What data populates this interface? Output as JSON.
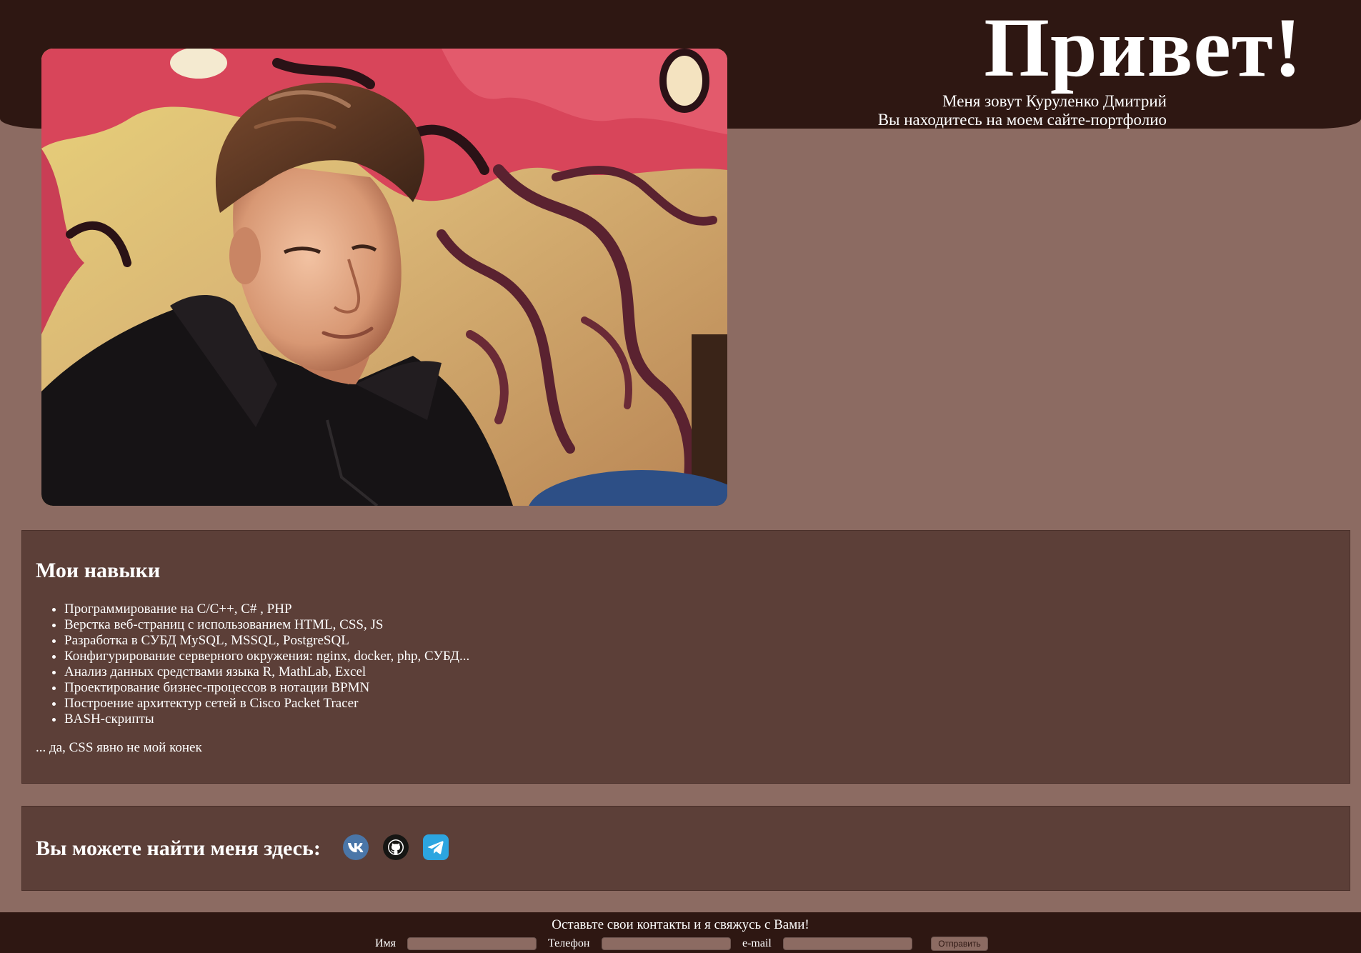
{
  "hero": {
    "title": "Привет!",
    "line1": "Меня зовут Куруленко Дмитрий",
    "line2": "Вы находитесь на моем сайте-портфолио"
  },
  "skills": {
    "heading": "Мои навыки",
    "items": [
      "Программирование на C/C++, C# , PHP",
      "Верстка веб-страниц с использованием HTML, CSS, JS",
      "Разработка в СУБД MySQL, MSSQL, PostgreSQL",
      "Конфигурирование серверного окружения: nginx, docker, php, СУБД...",
      "Анализ данных средствами языка R, MathLab, Excel",
      "Проектирование бизнес-процессов в нотации BPMN",
      "Построение архитектур сетей в Cisco Packet Tracer",
      "BASH-скрипты"
    ],
    "note": "... да, CSS явно не мой конек"
  },
  "socials": {
    "heading": "Вы можете найти меня здесь:",
    "links": [
      {
        "icon": "vk-icon",
        "color": "#4a76a8"
      },
      {
        "icon": "github-icon",
        "color": "#161614"
      },
      {
        "icon": "telegram-icon",
        "color": "#2ca5e0"
      }
    ]
  },
  "footer": {
    "title": "Оставьте свои контакты и я свяжусь с Вами!",
    "name_label": "Имя",
    "phone_label": "Телефон",
    "email_label": "e-mail",
    "name_value": "",
    "phone_value": "",
    "email_value": "",
    "submit_label": "Отправить"
  },
  "colors": {
    "page_background": "#8c6b62",
    "header_background": "#2e1712",
    "card_background": "#5c3f38",
    "text": "#ffffff"
  }
}
